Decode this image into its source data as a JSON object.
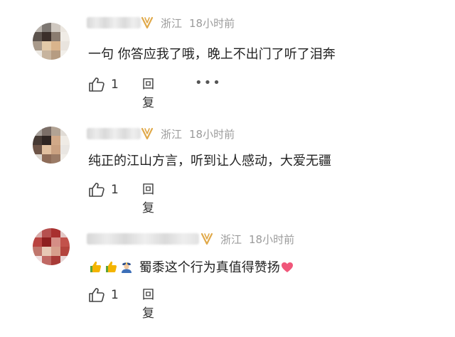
{
  "comments": [
    {
      "location": "浙江",
      "time": "18小时前",
      "text": "一句 你答应我了哦，晚上不出门了听了泪奔",
      "likes": "1",
      "reply_label": "回复",
      "more_label": "•••",
      "avatar_colors": [
        "#b9b3ac",
        "#7d7772",
        "#cfc8c0",
        "#ebe6df",
        "#5c534d",
        "#3b2f2a",
        "#8a7c70",
        "#f0ece6",
        "#a99a8b",
        "#e2c9a8",
        "#d9b48c",
        "#e9e4de",
        "#ece8e2",
        "#c7b49e",
        "#b69c82",
        "#f2efea"
      ]
    },
    {
      "location": "浙江",
      "time": "18小时前",
      "text": "纯正的江山方言，听到让人感动，大爱无疆",
      "likes": "1",
      "reply_label": "回复",
      "avatar_colors": [
        "#a7a09a",
        "#7b6e67",
        "#b2a394",
        "#e0dbd5",
        "#463a34",
        "#2f2522",
        "#d1a988",
        "#efebe5",
        "#6d5447",
        "#e1c0a0",
        "#caa181",
        "#e9e6e2",
        "#ded8d1",
        "#8e6c58",
        "#9b7b66",
        "#f1eee9"
      ]
    },
    {
      "location": "浙江",
      "time": "18小时前",
      "text": "蜀黍这个行为真值得赞扬",
      "likes": "1",
      "reply_label": "回复",
      "avatar_colors": [
        "#d9aaa8",
        "#b6504f",
        "#a8302f",
        "#e2c7c5",
        "#b94340",
        "#8e1f1f",
        "#d58e86",
        "#c2524b",
        "#c0766c",
        "#e7c8b5",
        "#d79f8c",
        "#b4443d",
        "#efdede",
        "#c06863",
        "#a83b37",
        "#e9d7d6"
      ]
    }
  ],
  "colors": {
    "vip_gold": "#e0a94a",
    "meta_gray": "#9b9b9b",
    "heart": "#f0577a",
    "thumb": "#f4b400",
    "leaf_green": "#6bb33c"
  }
}
